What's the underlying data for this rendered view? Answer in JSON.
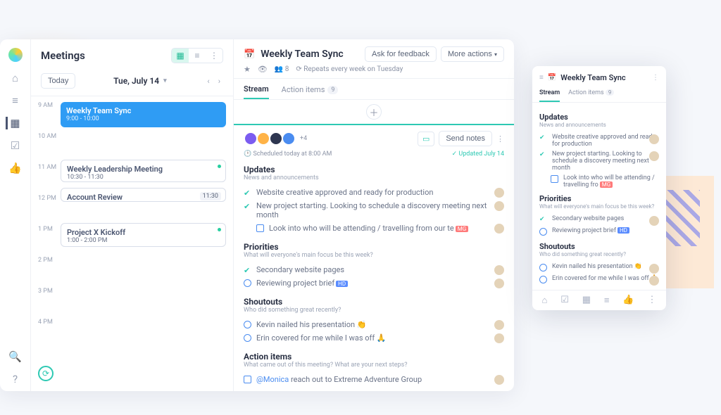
{
  "sidebar": {
    "title": "Meetings",
    "today_label": "Today",
    "date_label": "Tue, July 14"
  },
  "agenda": {
    "hours": [
      "9 AM",
      "10 AM",
      "11 AM",
      "12 PM",
      "1 PM",
      "2 PM",
      "3 PM",
      "4 PM"
    ],
    "events": [
      {
        "title": "Weekly Team Sync",
        "time": "9:00 - 10:00",
        "style": "primary"
      },
      {
        "title": "Weekly Leadership Meeting",
        "time": "10:30 - 11:30",
        "style": "outline",
        "dot": true
      },
      {
        "title": "Account Review",
        "badge": "11:30",
        "style": "outline"
      },
      {
        "title": "Project X Kickoff",
        "time": "1:00 - 2:00 PM",
        "style": "outline",
        "dot": true
      }
    ]
  },
  "doc": {
    "title": "Weekly Team Sync",
    "ask_feedback": "Ask for feedback",
    "more_actions": "More actions",
    "attendee_count": "8",
    "recurrence": "Repeats every week on Tuesday",
    "tab_stream": "Stream",
    "tab_actions": "Action items",
    "action_count": "9",
    "plus_attendees": "+4",
    "send_notes": "Send notes",
    "scheduled": "Scheduled today at 8:00 AM",
    "updated": "Updated July 14"
  },
  "sections": {
    "updates": {
      "title": "Updates",
      "sub": "News and announcements",
      "items": [
        {
          "kind": "done",
          "text": "Website creative approved and ready for production"
        },
        {
          "kind": "done",
          "text": "New project starting. Looking to schedule a discovery meeting next month"
        },
        {
          "kind": "todo",
          "text": "Look into who will be attending / travelling from our te",
          "tag": "MG"
        }
      ],
      "items_compact": [
        {
          "kind": "done",
          "text": "Website creative approved and ready for production"
        },
        {
          "kind": "done",
          "text": "New project starting. Looking to schedule a discovery meeting next month"
        },
        {
          "kind": "todo",
          "text": "Look into who will be attending / travelling fro",
          "tag": "MG"
        }
      ]
    },
    "priorities": {
      "title": "Priorities",
      "sub": "What will everyone's main focus be this week?",
      "items": [
        {
          "kind": "done",
          "text": "Secondary website pages"
        },
        {
          "kind": "open",
          "text": "Reviewing project brief",
          "tag": "HD",
          "tagcolor": "blue"
        }
      ]
    },
    "shoutouts": {
      "title": "Shoutouts",
      "sub": "Who did something great recently?",
      "items": [
        {
          "kind": "open",
          "text": "Kevin nailed his presentation 👏"
        },
        {
          "kind": "open",
          "text": "Erin covered for me while I was off 🙏"
        }
      ]
    },
    "action_items": {
      "title": "Action items",
      "sub": "What came out of this meeting? What are your next steps?",
      "items": [
        {
          "kind": "todo",
          "mention": "@Monica",
          "text": "reach out to Extreme Adventure Group"
        }
      ]
    }
  },
  "popup": {
    "title": "Weekly Team Sync",
    "tab_stream": "Stream",
    "tab_actions": "Action items",
    "action_count": "9"
  }
}
